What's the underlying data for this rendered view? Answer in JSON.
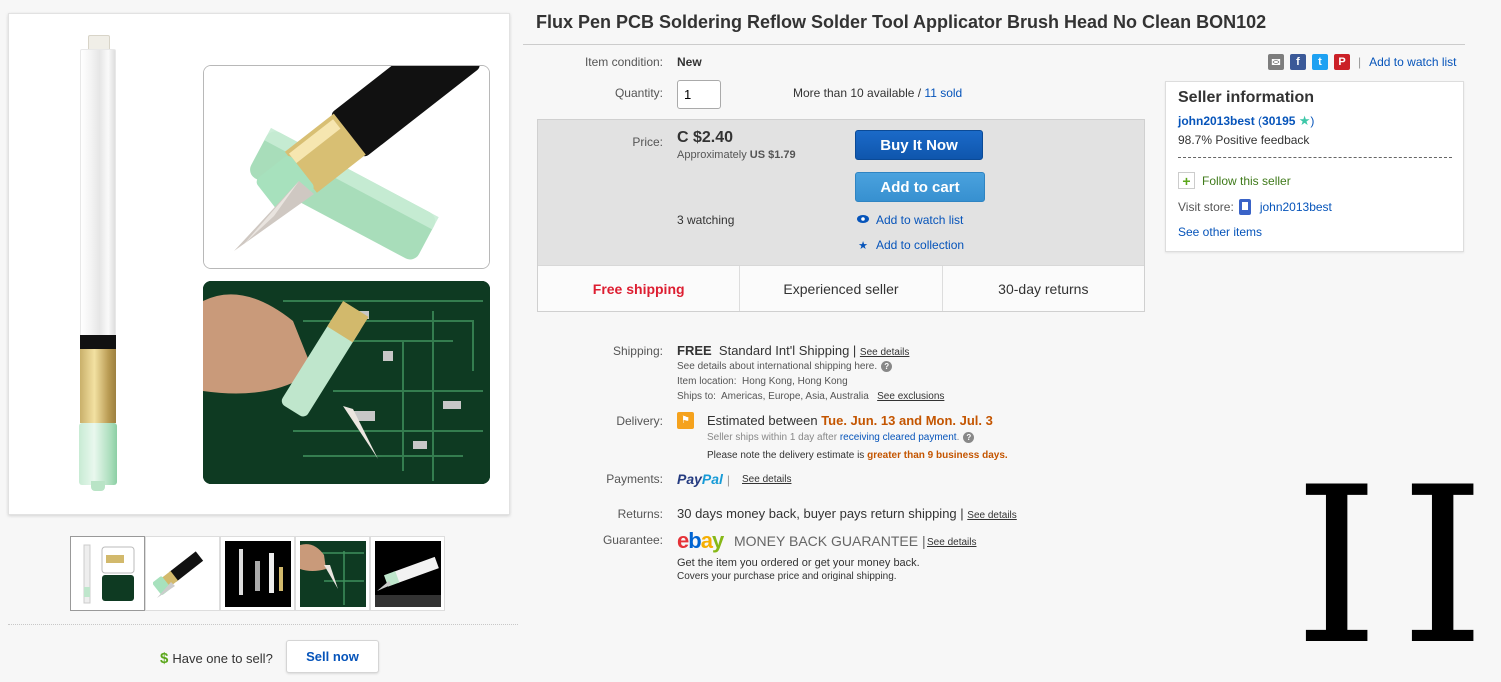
{
  "listing": {
    "title": "Flux Pen PCB Soldering Reflow Solder Tool Applicator Brush Head No Clean BON102"
  },
  "details": {
    "condition_label": "Item condition:",
    "condition_value": "New",
    "quantity_label": "Quantity:",
    "quantity_value": "1",
    "available_text": "More than 10 available / ",
    "sold_link": "11 sold",
    "price_label": "Price:",
    "price_value": "C $2.40",
    "approx_text": "Approximately ",
    "approx_value": "US $1.79",
    "watching_text": "3 watching",
    "buy_now_label": "Buy It Now",
    "add_to_cart_label": "Add to cart",
    "add_watch_label": "Add to watch list",
    "add_collection_label": "Add to collection"
  },
  "badges": [
    "Free shipping",
    "Experienced seller",
    "30-day returns"
  ],
  "shipping": {
    "label": "Shipping:",
    "free": "FREE",
    "method": "Standard Int'l Shipping",
    "see_details": "See details",
    "intl_note": "See details about international shipping here.",
    "location_label": "Item location:",
    "location_value": "Hong Kong, Hong Kong",
    "ships_to_label": "Ships to:",
    "ships_to_value": "Americas, Europe, Asia, Australia",
    "see_exclusions": "See exclusions"
  },
  "delivery": {
    "label": "Delivery:",
    "est_prefix": "Estimated between ",
    "est_dates": "Tue. Jun. 13 and Mon. Jul. 3",
    "ships_within": "Seller ships within 1 day after ",
    "cleared_link": "receiving cleared payment",
    "note_prefix": "Please note the delivery estimate is ",
    "note_highlight": "greater than 9 business days."
  },
  "payments": {
    "label": "Payments:",
    "paypal_1": "Pay",
    "paypal_2": "Pal",
    "see_details": "See details"
  },
  "returns": {
    "label": "Returns:",
    "text": "30 days money back, buyer pays return shipping",
    "see_details": "See details"
  },
  "guarantee": {
    "label": "Guarantee:",
    "logo_e": "e",
    "logo_b": "b",
    "logo_a": "a",
    "logo_y": "y",
    "mbg_text": "MONEY BACK GUARANTEE",
    "see_details": "See details",
    "line1": "Get the item you ordered or get your money back.",
    "line2": "Covers your purchase price and original shipping."
  },
  "share": {
    "mail_icon": "email-icon",
    "watch_label": "Add to watch list"
  },
  "seller": {
    "title": "Seller information",
    "username": "john2013best",
    "score": "30195",
    "positive": "98.7% Positive feedback",
    "follow": "Follow this seller",
    "visit_store_label": "Visit store:",
    "store_name": "john2013best",
    "other_items": "See other items"
  },
  "sell": {
    "have_one": "Have one to sell?",
    "sell_now": "Sell now"
  },
  "colors": {
    "buy_now": "#0f56ad",
    "add_to_cart": "#3790d0",
    "free_shipping": "#dd1e31",
    "delivery_highlight": "#c45500",
    "link": "#0654ba"
  }
}
